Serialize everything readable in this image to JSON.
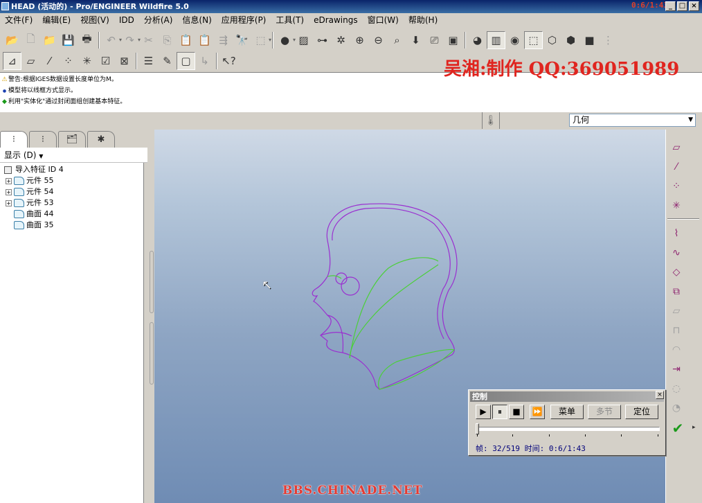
{
  "window": {
    "title": "HEAD (活动的) - Pro/ENGINEER Wildfire 5.0",
    "overlay_text": "0:6/1:43",
    "controls": [
      "_",
      "□",
      "×"
    ]
  },
  "menu": [
    "文件(F)",
    "编辑(E)",
    "视图(V)",
    "IDD",
    "分析(A)",
    "信息(N)",
    "应用程序(P)",
    "工具(T)",
    "eDrawings",
    "窗口(W)",
    "帮助(H)"
  ],
  "messages": [
    {
      "icon": "warning-icon",
      "symbol": "⚠",
      "color": "#d4a000",
      "text": "警告:根据IGES数据设置长度单位为M。"
    },
    {
      "icon": "info-dot-icon",
      "symbol": "●",
      "color": "#1a3fb0",
      "text": "模型将以线框方式显示。"
    },
    {
      "icon": "arrow-diamond-icon",
      "symbol": "◆",
      "color": "#1a9a1a",
      "text": "利用\"实体化\"通过封闭面组创建基本特征。"
    }
  ],
  "watermark_top": "吴湘:制作 QQ:369051989",
  "watermark_bottom": "BBS.CHINADE.NET",
  "filter": {
    "value": "几何"
  },
  "model_tree": {
    "show_label": "显示 (D)",
    "items": [
      {
        "label": "导入特征 ID 4",
        "level": 0,
        "expand": false,
        "kind": "root"
      },
      {
        "label": "元件 55",
        "level": 1,
        "expand": true,
        "kind": "quilt"
      },
      {
        "label": "元件 54",
        "level": 1,
        "expand": true,
        "kind": "quilt"
      },
      {
        "label": "元件 53",
        "level": 1,
        "expand": true,
        "kind": "quilt"
      },
      {
        "label": "曲面 44",
        "level": 1,
        "expand": false,
        "kind": "surface"
      },
      {
        "label": "曲面 35",
        "level": 1,
        "expand": false,
        "kind": "surface"
      }
    ]
  },
  "control_panel": {
    "title": "控制",
    "buttons": {
      "menu": "菜单",
      "multi": "多节",
      "locate": "定位"
    },
    "status": "帧: 32/519 时间: 0:6/1:43",
    "frame_current": 32,
    "frame_total": 519
  },
  "colors": {
    "curve_purple": "#9a2fd0",
    "curve_green": "#4ccf3a",
    "accent_red": "#e0251f"
  }
}
